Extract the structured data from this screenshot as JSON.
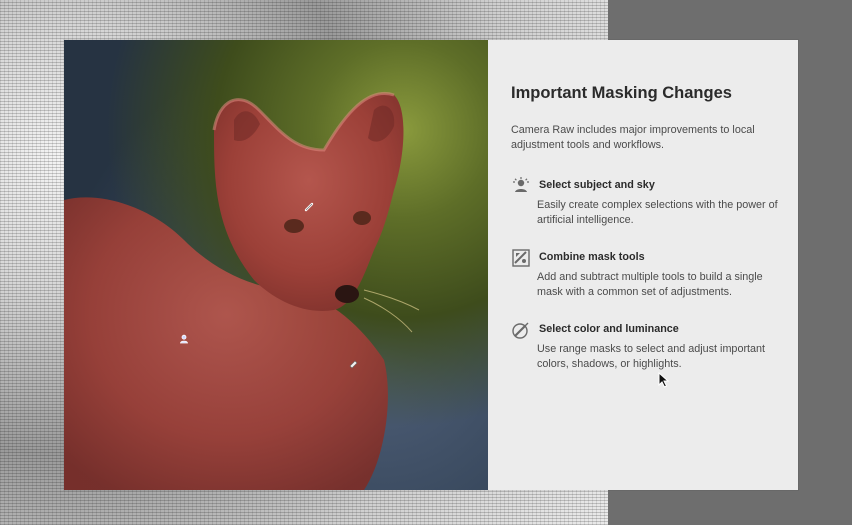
{
  "panel": {
    "title": "Important Masking Changes",
    "intro": "Camera Raw includes major improvements to local adjustment tools and workflows.",
    "features": [
      {
        "icon": "subject-sky-icon",
        "heading": "Select subject and sky",
        "description": "Easily create complex selections with the power of artificial intelligence."
      },
      {
        "icon": "combine-masks-icon",
        "heading": "Combine mask tools",
        "description": "Add and subtract multiple tools to build a single mask with a common set of adjustments."
      },
      {
        "icon": "color-luminance-icon",
        "heading": "Select color and luminance",
        "description": "Use range masks to select and adjust important colors, shadows, or highlights."
      }
    ]
  },
  "photo": {
    "subject": "arctic fox",
    "mask_overlay_color": "#d9574f"
  },
  "colors": {
    "panel_bg": "#ececec",
    "backdrop": "#6e6e6e"
  }
}
